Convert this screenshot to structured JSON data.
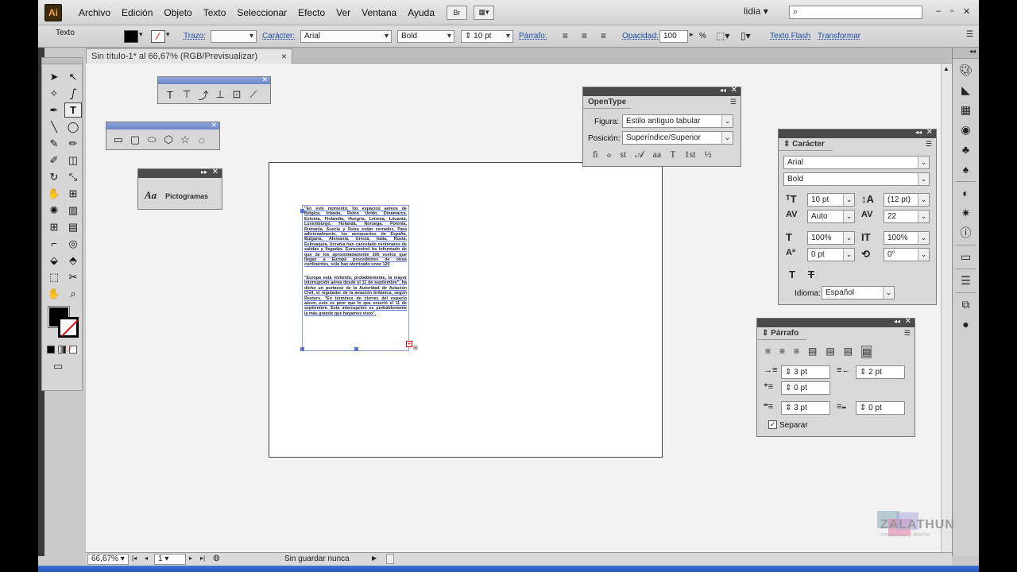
{
  "app": {
    "logo": "Ai",
    "user": "lidia",
    "search_value": ""
  },
  "menu": [
    "Archivo",
    "Edición",
    "Objeto",
    "Texto",
    "Seleccionar",
    "Efecto",
    "Ver",
    "Ventana",
    "Ayuda"
  ],
  "menubar_icons": [
    "Br",
    "layout"
  ],
  "window_buttons": [
    "–",
    "▫",
    "✕"
  ],
  "control": {
    "tool_label": "Texto",
    "trazo": "Trazo:",
    "caracter": "Carácter:",
    "font": "Arial",
    "style": "Bold",
    "size": "10 pt",
    "parrafo": "Párrafo:",
    "opacidad": "Opacidad:",
    "opacity_value": "100",
    "percent": "%",
    "texto_flash": "Texto Flash",
    "transformar": "Transformar"
  },
  "document_tab": {
    "title": "Sin título-1* al 66,67% (RGB/Previsualizar)",
    "close": "×"
  },
  "text_frame": {
    "p1": "\"En este momento, los espacios aéreos de Bélgica, Irlanda, Reino Unido, Dinamarca, Estonia, Finlandia, Hungría, Letonia, Lituania, Luxemburgo, Holanda, Noruega, Polonia, Rumanía, Suecia y Suiza están cerrados. Para adicionalmente, los aeropuertos de España, Bulgaria, Alemania, Grecia, Italia, Rusia, Eslovaquia, Ucrania han cancelado centenares de salidas y llegadas. Eurocontrol ha informado de que de los aproximadamente 300 vuelos que llegan a Europa procedentes de otros continentes, sólo han aterrizado unos 120",
    "p2": "\"Europa está viviendo, probablemente, la mayor interrupción aérea desde el 11 de septiembre\", ha dicho un portavoz de la Autoridad de Aviación Civil, el regulador de la aviación británica, según Reuters. \"En términos de cierres del espacio aéreo, esto es peor que lo que ocurrió el 11 de septiembre. Esta interrupción es probablemente la más grande que hayamos visto\"."
  },
  "pictogramas": {
    "label": "Pictogramas",
    "icon": "Aa"
  },
  "opentype": {
    "title": "OpenType",
    "figura_label": "Figura:",
    "figura_value": "Estilo antiguo tabular",
    "posicion_label": "Posición:",
    "posicion_value": "Superíndice/Superior",
    "glyphs": [
      "ﬁ",
      "ℴ",
      "st",
      "𝒜",
      "aa",
      "T",
      "1st",
      "½"
    ]
  },
  "caracter_panel": {
    "title": "Carácter",
    "font": "Arial",
    "style": "Bold",
    "size": "10 pt",
    "leading": "(12 pt)",
    "kerning": "Auto",
    "tracking": "22",
    "vscale": "100%",
    "hscale": "100%",
    "baseline": "0 pt",
    "rotation": "0°",
    "idioma_label": "Idioma:",
    "idioma_value": "Español"
  },
  "parrafo_panel": {
    "title": "Párrafo",
    "left_indent": "3 pt",
    "right_indent": "2 pt",
    "first_indent": "0 pt",
    "space_before": "3 pt",
    "space_after": "0 pt",
    "separar_label": "Separar"
  },
  "status": {
    "zoom": "66,67%",
    "page": "1",
    "state": "Sin guardar nunca"
  },
  "watermark": {
    "name": "ZALATHUN",
    "sub": "creatividad y diseño"
  },
  "colors": {
    "accent": "#6f86c8",
    "fill": "#000000",
    "stroke_none": "#e00000"
  }
}
